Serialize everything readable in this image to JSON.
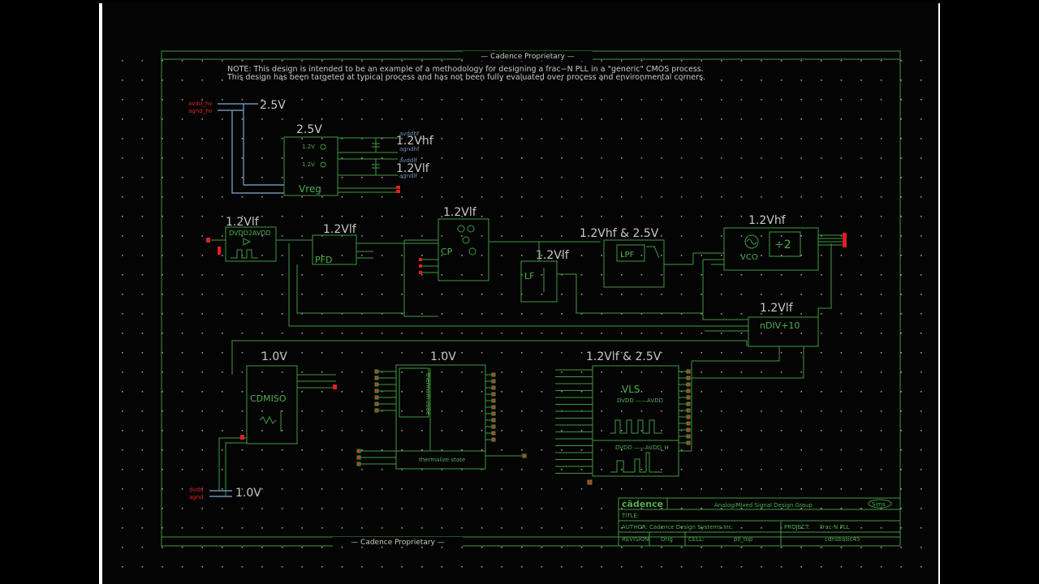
{
  "schematic": {
    "header": "— Cadence Proprietary —",
    "footer": "— Cadence Proprietary —",
    "note_line1": "NOTE: This design is intended to be an example of a methodology for designing a frac−N PLL in a \"generic\" CMOS process.",
    "note_line2": "This design has been targeted at typical process and has not been fully evaluated over process and environmental corners."
  },
  "supply": {
    "top_pins": [
      "avdd_hv",
      "agnd_hv"
    ],
    "top_label": "2.5V",
    "bottom_pins": [
      "dvdd",
      "agnd"
    ],
    "bottom_label": "1.0V"
  },
  "blocks": {
    "vreg": {
      "title": "2.5V",
      "name": "Vreg",
      "out1": "1.2V",
      "out2": "1.2V",
      "pins": [
        "avddhf",
        "agndhf",
        "avddlf",
        "agndlf"
      ],
      "rail1": "1.2Vhf",
      "rail2": "1.2Vlf"
    },
    "level_shift_in": {
      "title": "1.2Vlf",
      "name": "DVDD2AVDD"
    },
    "pfd": {
      "title": "1.2Vlf",
      "name": "PFD"
    },
    "cp": {
      "title": "1.2Vlf",
      "name": "CP"
    },
    "lf": {
      "title": "1.2Vlf",
      "name": "LF"
    },
    "lpf": {
      "title": "1.2Vhf & 2.5V",
      "name": "LPF"
    },
    "vco": {
      "title": "1.2Vhf",
      "name": "VCO",
      "divider": "÷2"
    },
    "ndiv": {
      "title": "1.2Vlf",
      "name": "nDIV+10"
    },
    "cdmiso": {
      "title": "1.0V",
      "name": "CDMISO"
    },
    "dsm": {
      "title": "1.0V",
      "sub": "thermom code",
      "bottom": "thermalize state"
    },
    "vls": {
      "title": "1.2Vlf & 2.5V",
      "name": "VLS",
      "line1": "DVDD ——AVDD",
      "line2": "DVDD ——AVDD_H"
    }
  },
  "titleblock": {
    "logo": "cādence",
    "group": "Analog/Mixed Signal Design Group",
    "badge": "Sims",
    "title_label": "TITLE:",
    "author_label": "AUTHOR:",
    "author": "Cadence Design Systems Inc.",
    "project_label": "PROJECT:",
    "project": "Frac-N PLL",
    "revision_label": "REVISION:",
    "revision": "Orig",
    "cell_label": "CELL:",
    "cell": "pll_top",
    "lib": "cdnsbasic45"
  },
  "colors": {
    "wire": "#3f9a3f",
    "supply": "#6f8fb0",
    "pin": "#e02020",
    "text": "#c8c8c8"
  }
}
